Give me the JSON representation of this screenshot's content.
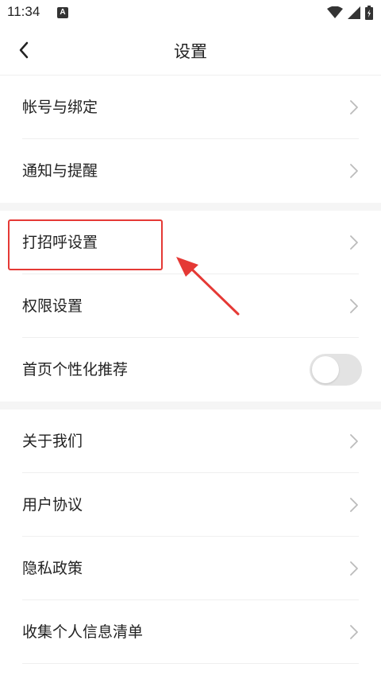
{
  "status_bar": {
    "time": "11:34",
    "a_badge": "A"
  },
  "header": {
    "title": "设置",
    "back_icon": "chevron-left-icon"
  },
  "section1": [
    {
      "label": "帐号与绑定"
    },
    {
      "label": "通知与提醒"
    }
  ],
  "section2": [
    {
      "label": "打招呼设置",
      "highlighted": true
    },
    {
      "label": "权限设置"
    },
    {
      "label": "首页个性化推荐",
      "toggle": false
    }
  ],
  "section3": [
    {
      "label": "关于我们"
    },
    {
      "label": "用户协议"
    },
    {
      "label": "隐私政策"
    },
    {
      "label": "收集个人信息清单"
    }
  ],
  "colors": {
    "annotation": "#e53935",
    "toggle_off": "#e3e3e3",
    "gap": "#f5f5f5"
  }
}
